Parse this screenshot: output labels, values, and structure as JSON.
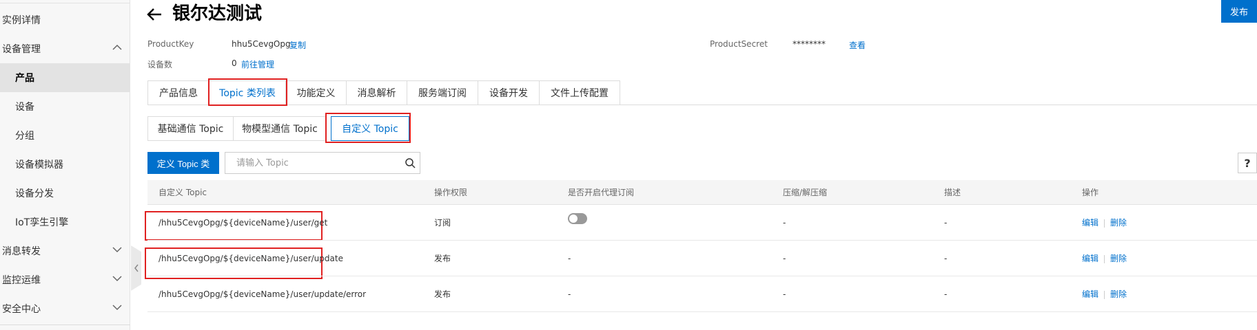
{
  "sidebar": {
    "items": [
      {
        "label": "实例详情",
        "level": 1,
        "chevron": "",
        "active": false
      },
      {
        "label": "设备管理",
        "level": 1,
        "chevron": "up",
        "active": false
      },
      {
        "label": "产品",
        "level": 2,
        "chevron": "",
        "active": true
      },
      {
        "label": "设备",
        "level": 2,
        "chevron": "",
        "active": false
      },
      {
        "label": "分组",
        "level": 2,
        "chevron": "",
        "active": false
      },
      {
        "label": "设备模拟器",
        "level": 2,
        "chevron": "",
        "active": false
      },
      {
        "label": "设备分发",
        "level": 2,
        "chevron": "",
        "active": false
      },
      {
        "label": "IoT孪生引擎",
        "level": 2,
        "chevron": "",
        "active": false
      },
      {
        "label": "消息转发",
        "level": 1,
        "chevron": "down",
        "active": false
      },
      {
        "label": "监控运维",
        "level": 1,
        "chevron": "down",
        "active": false
      },
      {
        "label": "安全中心",
        "level": 1,
        "chevron": "down",
        "active": false
      }
    ]
  },
  "header": {
    "title": "银尔达测试",
    "publish_label": "发布"
  },
  "meta": {
    "product_key_label": "ProductKey",
    "product_key_value": "hhu5CevgOpg",
    "copy_link": "复制",
    "device_count_label": "设备数",
    "device_count_value": "0",
    "manage_link": "前往管理",
    "product_secret_label": "ProductSecret",
    "product_secret_value": "********",
    "view_link": "查看"
  },
  "tabs": [
    "产品信息",
    "Topic 类列表",
    "功能定义",
    "消息解析",
    "服务端订阅",
    "设备开发",
    "文件上传配置"
  ],
  "active_tab": "Topic 类列表",
  "subtabs": [
    "基础通信 Topic",
    "物模型通信 Topic",
    "自定义 Topic"
  ],
  "active_subtab": "自定义 Topic",
  "toolbar": {
    "define_label": "定义 Topic 类",
    "search_placeholder": "请输入 Topic",
    "help_label": "?"
  },
  "table": {
    "columns": [
      "自定义 Topic",
      "操作权限",
      "是否开启代理订阅",
      "压缩/解压缩",
      "描述",
      "操作"
    ],
    "rows": [
      {
        "topic": "/hhu5CevgOpg/${deviceName}/user/get",
        "permission": "订阅",
        "proxy": "toggle-off",
        "compress": "-",
        "desc": "-",
        "edit": "编辑",
        "delete": "删除"
      },
      {
        "topic": "/hhu5CevgOpg/${deviceName}/user/update",
        "permission": "发布",
        "proxy": "-",
        "compress": "-",
        "desc": "-",
        "edit": "编辑",
        "delete": "删除"
      },
      {
        "topic": "/hhu5CevgOpg/${deviceName}/user/update/error",
        "permission": "发布",
        "proxy": "-",
        "compress": "-",
        "desc": "-",
        "edit": "编辑",
        "delete": "删除"
      }
    ]
  },
  "colors": {
    "accent": "#0070cc",
    "highlight": "#e02020"
  }
}
